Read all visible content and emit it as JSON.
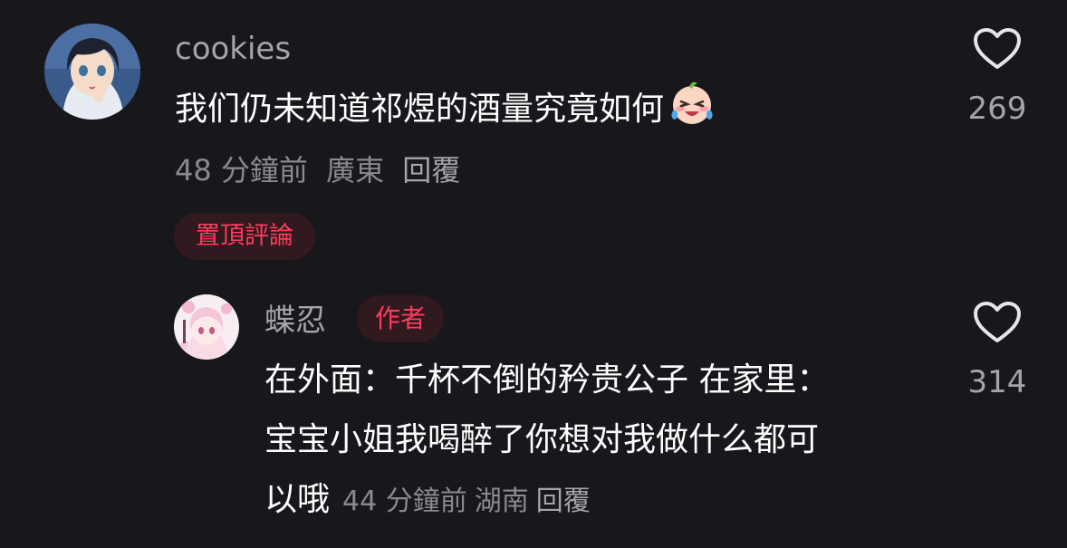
{
  "comments": [
    {
      "username": "cookies",
      "avatar": "anime-girl-avatar",
      "text": "我们仍未知道祁煜的酒量究竟如何",
      "emoji": "laughing-crying-face-emoji",
      "time": "48 分鐘前",
      "location": "廣東",
      "reply_label": "回覆",
      "pinned_label": "置頂評論",
      "likes": "269"
    }
  ],
  "reply": {
    "username": "蝶忍",
    "avatar": "pink-anime-girl-avatar",
    "author_badge": "作者",
    "lines": [
      "在外面：千杯不倒的矜贵公子 在家里：",
      "宝宝小姐我喝醉了你想对我做什么都可",
      "以哦"
    ],
    "time": "44 分鐘前",
    "location": "湖南",
    "reply_label": "回覆",
    "likes": "314"
  },
  "colors": {
    "background": "#18171c",
    "accent_red": "#ff3b5c",
    "muted_text": "#8a8990",
    "username": "#a5a4aa"
  }
}
